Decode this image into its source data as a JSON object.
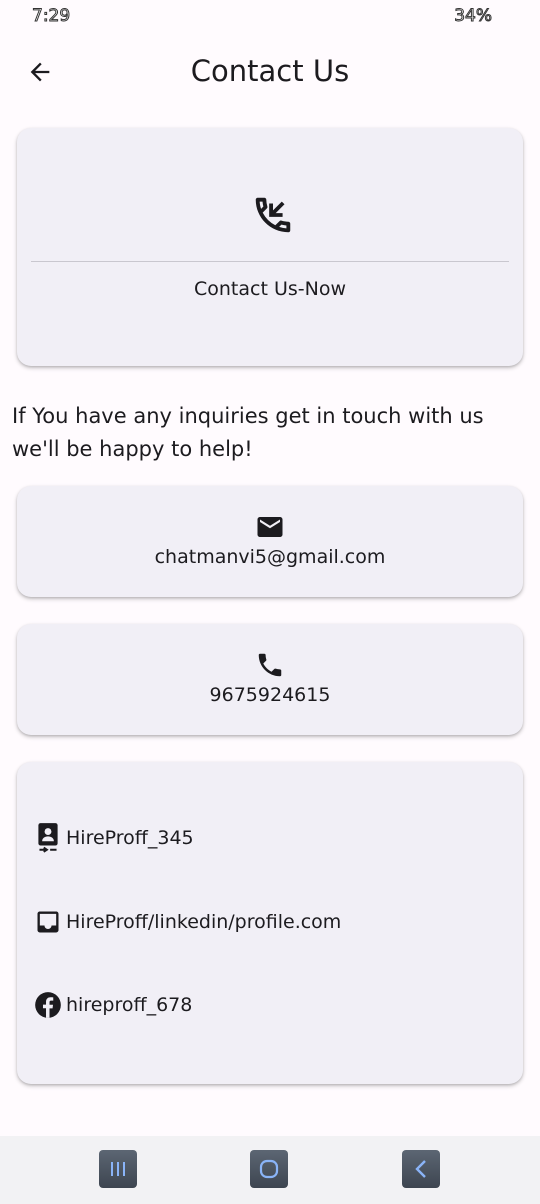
{
  "status": {
    "time": "7:29",
    "battery": "34%"
  },
  "app_bar": {
    "title": "Contact Us"
  },
  "hero": {
    "label": "Contact Us-Now"
  },
  "intro": "If You have any inquiries get in touch with us we'll be happy to help!",
  "email": {
    "value": "chatmanvi5@gmail.com"
  },
  "phone": {
    "value": "9675924615"
  },
  "social": [
    {
      "icon": "contact-badge-icon",
      "label": "HireProff_345"
    },
    {
      "icon": "inbox-icon",
      "label": "HireProff/linkedin/profile.com"
    },
    {
      "icon": "facebook-icon",
      "label": "hireproff_678"
    }
  ],
  "colors": {
    "background": "#fffbfe",
    "card": "#f1eff6",
    "text": "#1c1b1f"
  }
}
